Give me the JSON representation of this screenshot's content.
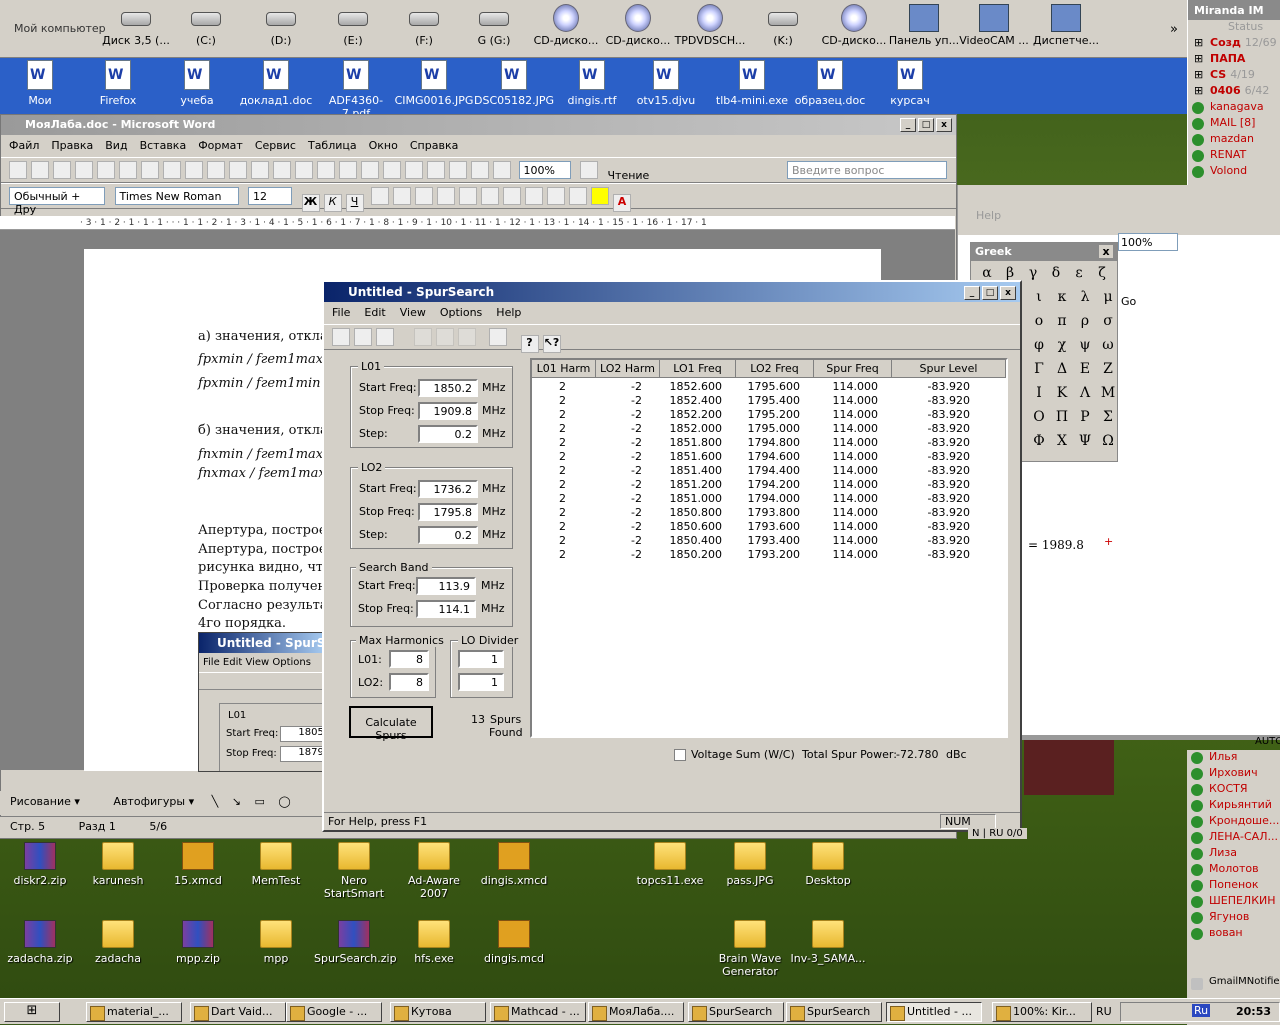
{
  "topbar": {
    "label": "Мой компьютер",
    "items": [
      {
        "label": "Диск 3,5 (...",
        "type": "floppy"
      },
      {
        "label": "(C:)",
        "type": "drive"
      },
      {
        "label": "(D:)",
        "type": "drive"
      },
      {
        "label": "(E:)",
        "type": "drive"
      },
      {
        "label": "(F:)",
        "type": "drive"
      },
      {
        "label": "G (G:)",
        "type": "drive"
      },
      {
        "label": "CD-диско...",
        "type": "cd"
      },
      {
        "label": "CD-диско...",
        "type": "cd"
      },
      {
        "label": "TPDVDSCH...",
        "type": "cd"
      },
      {
        "label": "(K:)",
        "type": "drive"
      },
      {
        "label": "CD-диско...",
        "type": "cd"
      },
      {
        "label": "Панель уп...",
        "type": "control"
      },
      {
        "label": "VideoCAM ...",
        "type": "camera"
      },
      {
        "label": "Диспетче...",
        "type": "manager"
      }
    ]
  },
  "row2": {
    "items": [
      "Мои",
      "Firefox",
      "учеба",
      "доклад1.doc",
      "ADF4360-7.pdf",
      "CIMG0016.JPG",
      "DSC05182.JPG",
      "dingis.rtf",
      "otv15.djvu",
      "tlb4-mini.exe",
      "образец.doc",
      "курсач"
    ]
  },
  "miranda": {
    "title": "Miranda IM",
    "status": "Status",
    "groups": [
      {
        "label": "Созд",
        "count": "12/69"
      },
      {
        "label": "ПАПА",
        "count": ""
      },
      {
        "label": "CS",
        "count": "4/19"
      },
      {
        "label": "0406",
        "count": "6/42"
      }
    ],
    "contacts": [
      "kanagava",
      "MAIL [8]",
      "mazdan",
      "RENAT",
      "Volond"
    ]
  },
  "word": {
    "title": "МояЛаба.doc - Microsoft Word",
    "menu": [
      "Файл",
      "Правка",
      "Вид",
      "Вставка",
      "Формат",
      "Сервис",
      "Таблица",
      "Окно",
      "Справка"
    ],
    "ask_placeholder": "Введите вопрос",
    "zoom": "100%",
    "read_label": "Чтение",
    "style": "Обычный + Дру",
    "font": "Times New Roman",
    "size": "12",
    "ruler": "· 3 · 1 · 2 · 1 · 1 · 1 · · · 1 · 1 · 2 · 1 · 3 · 1 · 4 · 1 · 5 · 1 · 6 · 1 · 7 · 1 · 8 · 1 · 9 · 1 · 10 · 1 · 11 · 1 · 12 · 1 · 13 · 1 · 14 · 1 · 15 · 1 · 16 · 1 · 17 · 1",
    "doc_lines": [
      "а) значения, отклад",
      "fpxmin / fгет1max=1,0",
      "fpxmin / fгет1min =1,0",
      "б) значения, отклад",
      "fпхmin / fгет1max=0,0",
      "fпхmax / fгет1max=0,0",
      "Апертура, построе",
      "Апертура, построе",
      "рисунка видно, чт",
      "Проверка получен",
      "Согласно результа",
      "4го порядка."
    ],
    "draw_label": "Рисование",
    "autoshapes": "Автофигуры",
    "status": {
      "page": "Стр. 5",
      "section": "Разд 1",
      "pages": "5/6"
    }
  },
  "greek": {
    "title": "Greek",
    "chars": [
      "α",
      "β",
      "γ",
      "δ",
      "ε",
      "ζ",
      "ι",
      "κ",
      "λ",
      "μ",
      "ο",
      "π",
      "ρ",
      "σ",
      "φ",
      "χ",
      "ψ",
      "ω",
      "Γ",
      "Δ",
      "Ε",
      "Ζ",
      "Ι",
      "Κ",
      "Λ",
      "Μ",
      "Ο",
      "Π",
      "Ρ",
      "Σ",
      "Φ",
      "Χ",
      "Ψ",
      "Ω"
    ]
  },
  "rightwin": {
    "zoom": "100%",
    "help": "Help",
    "go": "Go",
    "value": "= 1989.8",
    "autorun": "AUTO"
  },
  "spur": {
    "title": "Untitled - SpurSearch",
    "menu": [
      "File",
      "Edit",
      "View",
      "Options",
      "Help"
    ],
    "lo1": {
      "title": "L01",
      "start_label": "Start Freq:",
      "start": "1850.2",
      "stop_label": "Stop Freq:",
      "stop": "1909.8",
      "step_label": "Step:",
      "step": "0.2",
      "unit": "MHz"
    },
    "lo2": {
      "title": "LO2",
      "start_label": "Start Freq:",
      "start": "1736.2",
      "stop_label": "Stop Freq:",
      "stop": "1795.8",
      "step_label": "Step:",
      "step": "0.2",
      "unit": "MHz"
    },
    "band": {
      "title": "Search Band",
      "start_label": "Start Freq:",
      "start": "113.9",
      "stop_label": "Stop Freq:",
      "stop": "114.1",
      "unit": "MHz"
    },
    "harm": {
      "title": "Max Harmonics",
      "lo1_label": "L01:",
      "lo1": "8",
      "lo2_label": "LO2:",
      "lo2": "8"
    },
    "div": {
      "title": "LO Divider",
      "lo1": "1",
      "lo2": "1"
    },
    "calc_label": "Calculate Spurs",
    "spurs_found": "13",
    "spurs_label": "Spurs",
    "found_label": "Found",
    "voltage_label": "Voltage Sum (W/C)",
    "total_label": "Total Spur Power:",
    "total_value": "-72.780",
    "total_unit": "dBc",
    "status_help": "For Help, press F1",
    "status_num": "NUM",
    "columns": [
      "L01 Harm",
      "LO2 Harm",
      "LO1 Freq",
      "LO2 Freq",
      "Spur Freq",
      "Spur Level"
    ],
    "rows": [
      [
        "2",
        "-2",
        "1852.600",
        "1795.600",
        "114.000",
        "-83.920"
      ],
      [
        "2",
        "-2",
        "1852.400",
        "1795.400",
        "114.000",
        "-83.920"
      ],
      [
        "2",
        "-2",
        "1852.200",
        "1795.200",
        "114.000",
        "-83.920"
      ],
      [
        "2",
        "-2",
        "1852.000",
        "1795.000",
        "114.000",
        "-83.920"
      ],
      [
        "2",
        "-2",
        "1851.800",
        "1794.800",
        "114.000",
        "-83.920"
      ],
      [
        "2",
        "-2",
        "1851.600",
        "1794.600",
        "114.000",
        "-83.920"
      ],
      [
        "2",
        "-2",
        "1851.400",
        "1794.400",
        "114.000",
        "-83.920"
      ],
      [
        "2",
        "-2",
        "1851.200",
        "1794.200",
        "114.000",
        "-83.920"
      ],
      [
        "2",
        "-2",
        "1851.000",
        "1794.000",
        "114.000",
        "-83.920"
      ],
      [
        "2",
        "-2",
        "1850.800",
        "1793.800",
        "114.000",
        "-83.920"
      ],
      [
        "2",
        "-2",
        "1850.600",
        "1793.600",
        "114.000",
        "-83.920"
      ],
      [
        "2",
        "-2",
        "1850.400",
        "1793.400",
        "114.000",
        "-83.920"
      ],
      [
        "2",
        "-2",
        "1850.200",
        "1793.200",
        "114.000",
        "-83.920"
      ]
    ]
  },
  "inner": {
    "title": "Untitled - SpurSearch",
    "menu": "File  Edit  View  Options",
    "lo1": "L01",
    "start_label": "Start Freq:",
    "start": "1805.",
    "stop_label": "Stop Freq:",
    "stop": "1879."
  },
  "desktop": {
    "row1": [
      "diskr2.zip",
      "karunesh",
      "15.xmcd",
      "MemTest",
      "Nero StartSmart",
      "Ad-Aware 2007",
      "dingis.xmcd",
      "topcs11.exe",
      "pass.JPG",
      "Desktop"
    ],
    "row2": [
      "zadacha.zip",
      "zadacha",
      "mpp.zip",
      "mpp",
      "SpurSearch.zip",
      "hfs.exe",
      "dingis.mcd",
      "Brain Wave Generator",
      "Inv-3_SAMA..."
    ]
  },
  "contacts": [
    "Илья",
    "Ирхович",
    "КОСТЯ",
    "Кирьянтий",
    "Крондоше...",
    "ЛЕНА-САЛ...",
    "Лиза",
    "Молотов",
    "Попенок",
    "ШЕПЕЛКИН",
    "Ягунов",
    "вован"
  ],
  "gmail": "GmailMNotifier",
  "mini_status": "N | RU 0/0",
  "taskbar": {
    "tasks": [
      "material_...",
      "Dart Vaid...",
      "Google - ...",
      "Кутова",
      "Mathcad - ...",
      "МояЛаба....",
      "SpurSearch",
      "SpurSearch",
      "Untitled - ...",
      "100%: Kir..."
    ],
    "lang": "RU",
    "tray_lang": "Ru",
    "time": "20:53"
  }
}
